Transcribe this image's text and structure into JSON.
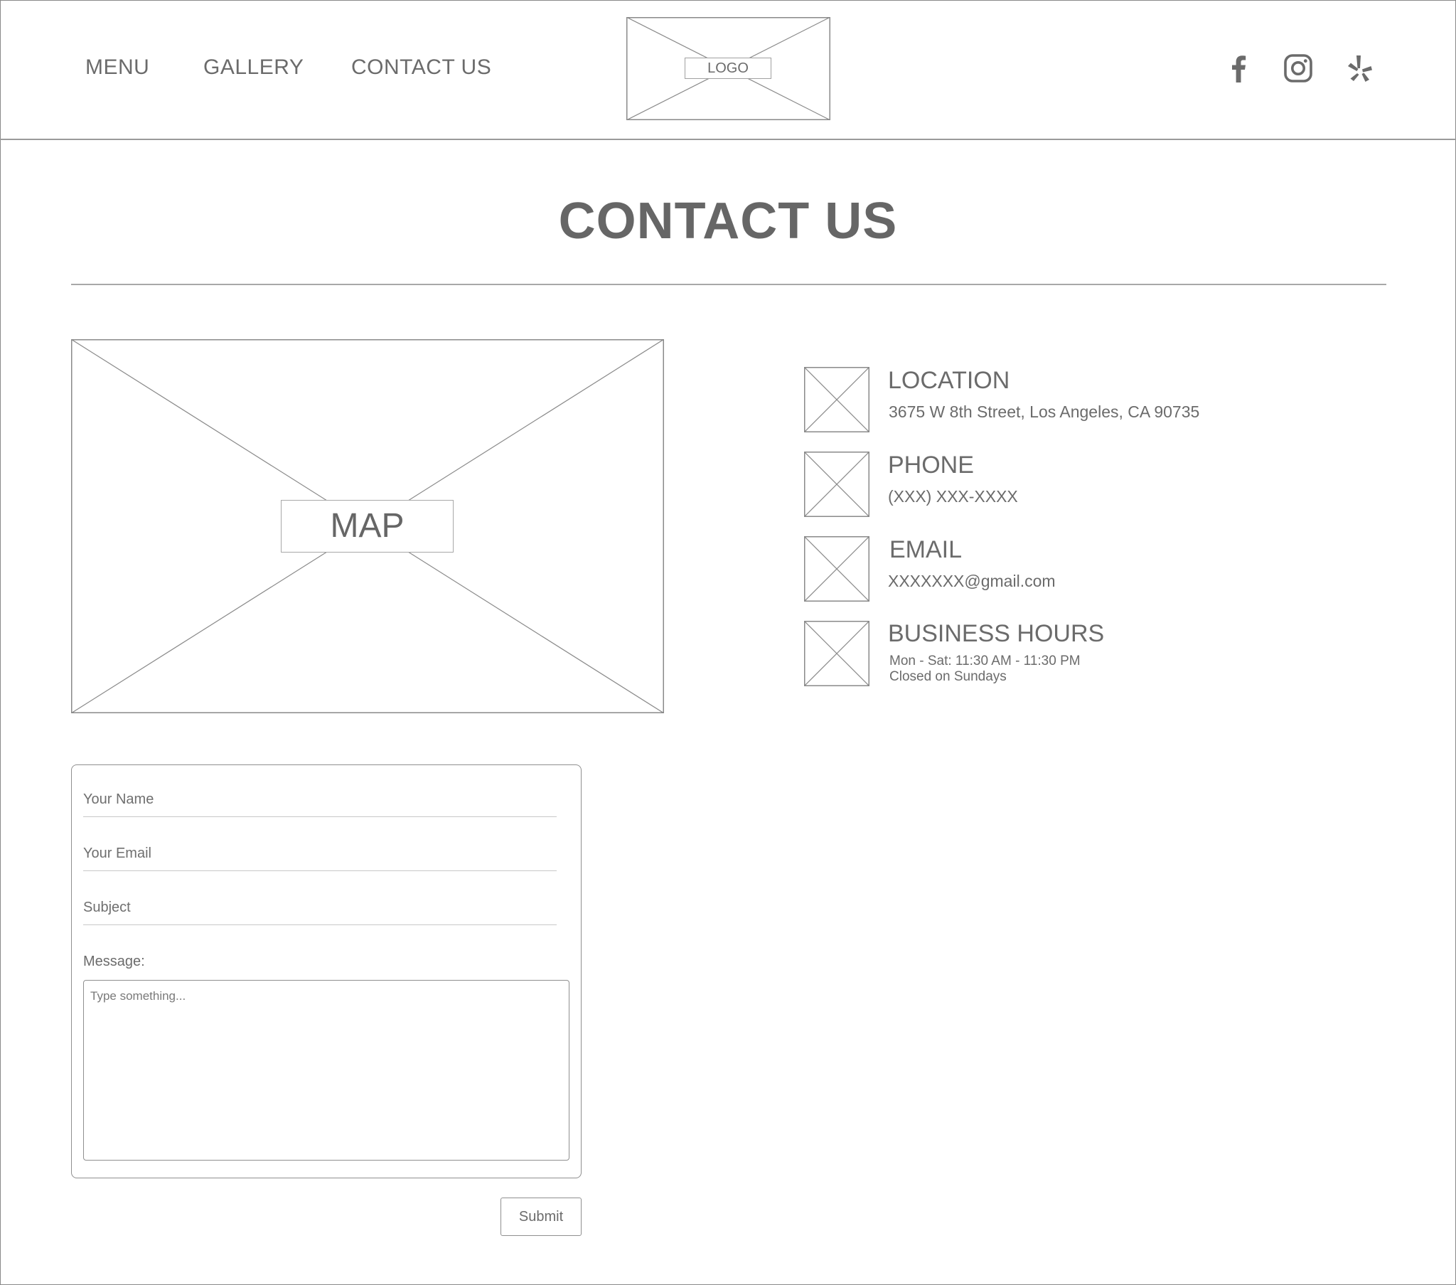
{
  "nav": {
    "menu": "MENU",
    "gallery": "GALLERY",
    "contact": "CONTACT US"
  },
  "logo": {
    "label": "LOGO"
  },
  "social": {
    "icons": [
      "facebook-icon",
      "instagram-icon",
      "yelp-icon"
    ]
  },
  "page": {
    "title": "CONTACT US"
  },
  "map": {
    "label": "MAP"
  },
  "info": {
    "location": {
      "title": "LOCATION",
      "text": "3675 W 8th Street, Los Angeles, CA 90735"
    },
    "phone": {
      "title": "PHONE",
      "text": "(XXX) XXX-XXXX"
    },
    "email": {
      "title": "EMAIL",
      "text": "XXXXXXX@gmail.com"
    },
    "hours": {
      "title": "BUSINESS HOURS",
      "line1": "Mon - Sat: 11:30 AM - 11:30 PM",
      "line2": "Closed on Sundays"
    }
  },
  "form": {
    "name_placeholder": "Your Name",
    "email_placeholder": "Your Email",
    "subject_placeholder": "Subject",
    "message_label": "Message:",
    "message_placeholder": "Type something...",
    "submit_label": "Submit"
  },
  "colors": {
    "text": "#6b6b6b",
    "border": "#8f8f8f",
    "background": "#ffffff"
  }
}
